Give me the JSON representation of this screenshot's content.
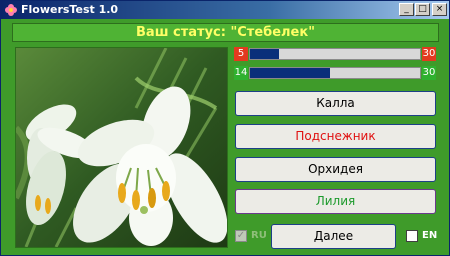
{
  "window": {
    "title": "FlowersTest 1.0",
    "minimize": "_",
    "maximize": "□",
    "close": "×"
  },
  "status": {
    "text": "Ваш статус: \"Стебелек\""
  },
  "scores": {
    "wrong": {
      "current": "5",
      "max": "30",
      "fraction": 0.17,
      "color": "#e23a1f"
    },
    "correct": {
      "current": "14",
      "max": "30",
      "fraction": 0.47,
      "color": "#2fb12f"
    }
  },
  "answers": [
    {
      "label": "Калла",
      "state": "normal"
    },
    {
      "label": "Подснежник",
      "state": "wrong"
    },
    {
      "label": "Орхидея",
      "state": "normal"
    },
    {
      "label": "Лилия",
      "state": "correct"
    }
  ],
  "controls": {
    "ru_label": "RU",
    "ru_checked": true,
    "next_label": "Далее",
    "en_label": "EN",
    "en_checked": false
  },
  "icons": {
    "app": "flower-icon",
    "checkmark": "✓"
  }
}
